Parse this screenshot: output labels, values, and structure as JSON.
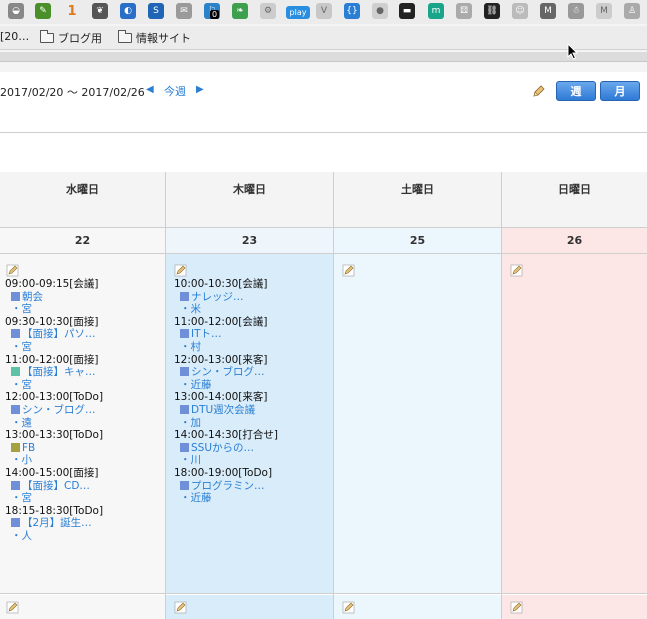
{
  "extensions": [
    {
      "name": "pocket-icon",
      "color": "#888888",
      "glyph": "◒"
    },
    {
      "name": "evernote-clipper-icon",
      "color": "#4a8f2a",
      "glyph": "✎"
    },
    {
      "name": "number-one-icon",
      "color": "#ffffff",
      "glyph": ""
    },
    {
      "name": "evernote-icon",
      "color": "#555555",
      "glyph": "❦"
    },
    {
      "name": "globe-icon",
      "color": "#2a6fc7",
      "glyph": "◐"
    },
    {
      "name": "s-icon",
      "color": "#1f64b5",
      "glyph": "S"
    },
    {
      "name": "mail-icon",
      "color": "#9a9a9a",
      "glyph": "✉"
    },
    {
      "name": "notification-badge-icon",
      "color": "#2a82c9",
      "glyph": "⚐"
    },
    {
      "name": "leaf-icon",
      "color": "#3ea04f",
      "glyph": "❧"
    },
    {
      "name": "gear-icon",
      "color": "#cccccc",
      "glyph": "⚙"
    },
    {
      "name": "play-icon",
      "color": "#2a8ee0",
      "glyph": ""
    },
    {
      "name": "v-icon",
      "color": "#c8c8c8",
      "glyph": "V"
    },
    {
      "name": "code-icon",
      "color": "#2a7fd4",
      "glyph": "{}"
    },
    {
      "name": "circle-icon",
      "color": "#cfcfcf",
      "glyph": "●"
    },
    {
      "name": "terminal-icon",
      "color": "#222222",
      "glyph": "▬"
    },
    {
      "name": "m-teal-icon",
      "color": "#1aa58a",
      "glyph": "m"
    },
    {
      "name": "dice-icon",
      "color": "#aaaaaa",
      "glyph": "⚄"
    },
    {
      "name": "link-icon",
      "color": "#222222",
      "glyph": "⛓"
    },
    {
      "name": "face-icon",
      "color": "#bbbbbb",
      "glyph": "☺"
    },
    {
      "name": "m-gray-icon",
      "color": "#666666",
      "glyph": "M"
    },
    {
      "name": "ghost-icon",
      "color": "#999999",
      "glyph": "☃"
    },
    {
      "name": "m-light-icon",
      "color": "#cccccc",
      "glyph": "M"
    },
    {
      "name": "person-icon",
      "color": "#aaaaaa",
      "glyph": "♙"
    }
  ],
  "ext_text": {
    "one": "1",
    "badge": "0",
    "play": "play"
  },
  "bookmarks": {
    "first": "[20…",
    "items": [
      {
        "label": "ブログ用"
      },
      {
        "label": "情報サイト"
      }
    ]
  },
  "nav": {
    "range": "2017/02/20 〜 2017/02/26",
    "prev": "◀",
    "this_week": "今週",
    "next": "▶",
    "week_btn": "週",
    "month_btn": "月"
  },
  "days": [
    {
      "name": "水曜日",
      "num": "22"
    },
    {
      "name": "木曜日",
      "num": "23"
    },
    {
      "name": "土曜日",
      "num": "25"
    },
    {
      "name": "日曜日",
      "num": "26"
    }
  ],
  "events": {
    "wed": [
      {
        "time": "09:00-09:15[会議]",
        "title": "朝会",
        "user": "・宮",
        "color": "#6f8fd9"
      },
      {
        "time": "09:30-10:30[面接]",
        "title": "【面接】パソ…",
        "user": "・宮",
        "color": "#6f8fd9"
      },
      {
        "time": "11:00-12:00[面接]",
        "title": "【面接】キャ…",
        "user": "・宮",
        "color": "#5ec3a6"
      },
      {
        "time": "12:00-13:00[ToDo]",
        "title": "シン・ブログ…",
        "user": "・遠",
        "color": "#6f8fd9"
      },
      {
        "time": "13:00-13:30[ToDo]",
        "title": "FB",
        "user": "・小",
        "color": "#a5a040"
      },
      {
        "time": "14:00-15:00[面接]",
        "title": "【面接】CD…",
        "user": "・宮",
        "color": "#6f8fd9"
      },
      {
        "time": "18:15-18:30[ToDo]",
        "title": "【2月】誕生…",
        "user": "・人",
        "color": "#6f8fd9"
      }
    ],
    "thu": [
      {
        "time": "10:00-10:30[会議]",
        "title": "ナレッジ…",
        "user": "・米",
        "color": "#6f8fd9"
      },
      {
        "time": "11:00-12:00[会議]",
        "title": "ITト…",
        "user": "・村",
        "color": "#6f8fd9"
      },
      {
        "time": "12:00-13:00[来客]",
        "title": "シン・ブログ…",
        "user": "・近藤",
        "color": "#6f8fd9"
      },
      {
        "time": "13:00-14:00[来客]",
        "title": "DTU週次会議",
        "user": "・加",
        "color": "#6f8fd9"
      },
      {
        "time": "14:00-14:30[打合せ]",
        "title": "SSUからの…",
        "user": "・川",
        "color": "#6f8fd9"
      },
      {
        "time": "18:00-19:00[ToDo]",
        "title": "プログラミン…",
        "user": "・近藤",
        "color": "#6f8fd9"
      }
    ]
  }
}
